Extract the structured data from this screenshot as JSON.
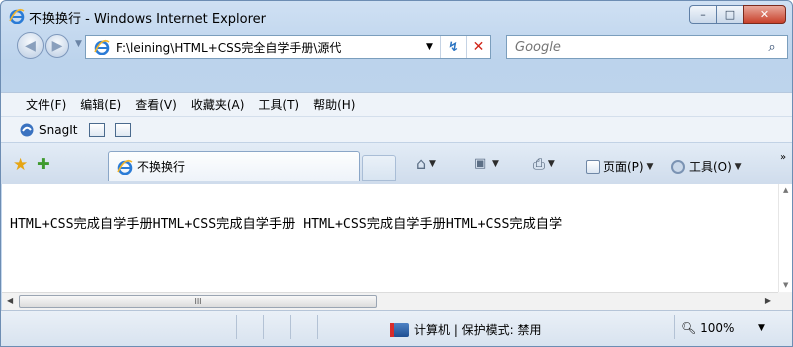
{
  "window": {
    "title": "不换换行 - Windows Internet Explorer"
  },
  "caption_buttons": {
    "minimize": "–",
    "maximize": "□",
    "close": "✕"
  },
  "address": {
    "url": "F:\\leining\\HTML+CSS完全自学手册\\源代",
    "refresh": "↯",
    "stop": "✕"
  },
  "search": {
    "placeholder": "Google",
    "button_icon": "⌕"
  },
  "menu": [
    "文件(F)",
    "编辑(E)",
    "查看(V)",
    "收藏夹(A)",
    "工具(T)",
    "帮助(H)"
  ],
  "snagit": {
    "label": "SnagIt"
  },
  "tab": {
    "label": "不换换行"
  },
  "commands": {
    "page": "页面(P)",
    "tools": "工具(O)",
    "more": "»"
  },
  "content": {
    "text": "HTML+CSS完成自学手册HTML+CSS完成自学手册 HTML+CSS完成自学手册HTML+CSS完成自学"
  },
  "scroll": {
    "thumb_grip": "III"
  },
  "status": {
    "zone": "计算机 | 保护模式: 禁用",
    "zoom": "100%"
  }
}
